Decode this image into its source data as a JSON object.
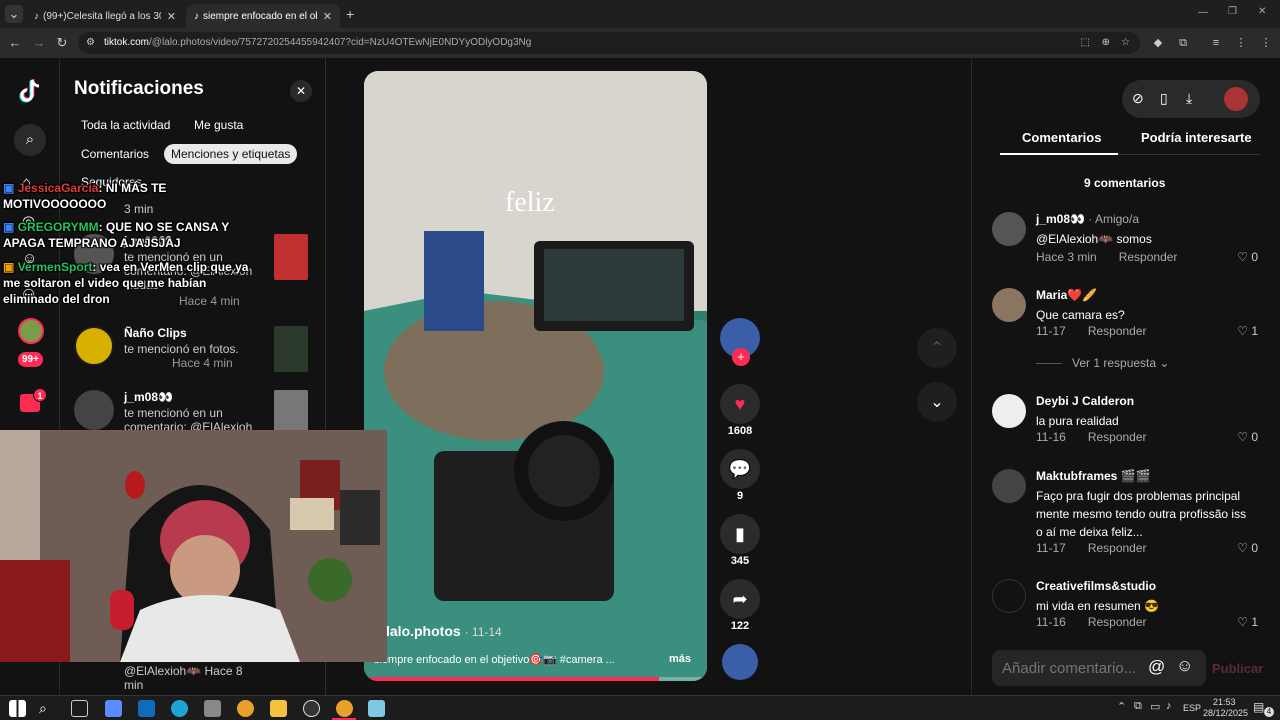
{
  "tabs": [
    {
      "title": "(99+)Celesita llegó a los 300k💗",
      "close": "✕"
    },
    {
      "title": "siempre enfocado en el objetivo",
      "close": "✕"
    }
  ],
  "new_tab": "+",
  "window_controls": [
    "—",
    "❐",
    "✕"
  ],
  "address": {
    "domain": "tiktok.com",
    "path": "/@lalo.photos/video/7572720254455942407?cid=NzU4OTEwNjE0NDYyODlyODg3Ng"
  },
  "notifications": {
    "title": "Notificaciones",
    "close": "✕",
    "filters": [
      "Toda la actividad",
      "Me gusta",
      "Comentarios",
      "Menciones y etiquetas",
      "Seguidores"
    ],
    "items": [
      {
        "name": "",
        "text": "3 min"
      },
      {
        "name": "j_m08👀",
        "text": "te mencionó en un comentario: @ElAlexioh viudas",
        "time": "Hace 4 min"
      },
      {
        "name": "Ñaño Clips",
        "text": "te mencionó en fotos.",
        "time": "Hace 4 min"
      },
      {
        "name": "j_m08👀",
        "text": "te mencionó en un comentario: @ElAlexioh"
      },
      {
        "name": "",
        "text": "@ElAlexioh🦇 Hace 8 min"
      }
    ]
  },
  "chat_overlay": [
    {
      "user": "JessicaGarcia",
      "msg": ": NI MÁS TE MOTIVOOOOOOO"
    },
    {
      "user": "GREGORYMM",
      "msg": ": QUE NO SE CANSA Y APAGA TEMPRANO AJAJSJAJ"
    },
    {
      "user": "VermenSport",
      "msg": ": vea en VerMen clip que ya me soltaron el video que me habían eliminado del dron"
    }
  ],
  "video": {
    "caption_word": "feliz",
    "author": "lalo.photos",
    "date": "11-14",
    "description": "siempre enfocado en el objetivo🎯📷 #camera ...",
    "more": "más"
  },
  "actions": {
    "likes": "1608",
    "comments": "9",
    "saves": "345",
    "shares": "122"
  },
  "right_panel": {
    "tabs": [
      "Comentarios",
      "Podría interesarte"
    ],
    "count_label": "9 comentarios",
    "reply_label": "Responder",
    "view_replies": "Ver 1 respuesta",
    "comments": [
      {
        "user": "j_m08👀",
        "sub": " · Amigo/a",
        "text": "@ElAlexioh🦇 somos",
        "meta": "Hace 3 min",
        "likes": "0"
      },
      {
        "user": "Maria❤️🥖",
        "sub": "",
        "text": "Que camara es?",
        "meta": "11-17",
        "likes": "1"
      },
      {
        "user": "Deybi J Calderon",
        "sub": "",
        "text": "la pura realidad",
        "meta": "11-16",
        "likes": "0"
      },
      {
        "user": "Maktubframes 🎬🎬",
        "sub": "",
        "text": "Faço pra fugir dos problemas principalmente mesmo tendo outra profissão isso aí me deixa feliz...",
        "meta": "11-17",
        "likes": "0"
      },
      {
        "user": "Creativefilms&studio",
        "sub": "",
        "text": "mi vida en resumen 😎",
        "meta": "11-16",
        "likes": "1"
      }
    ],
    "input_placeholder": "Añadir comentario...",
    "publish": "Publicar"
  },
  "taskbar": {
    "lang": "ESP",
    "time": "21:53",
    "date": "28/12/2025",
    "badge": "4"
  },
  "nav_badges": {
    "inbox": "99+",
    "messages": "1"
  }
}
